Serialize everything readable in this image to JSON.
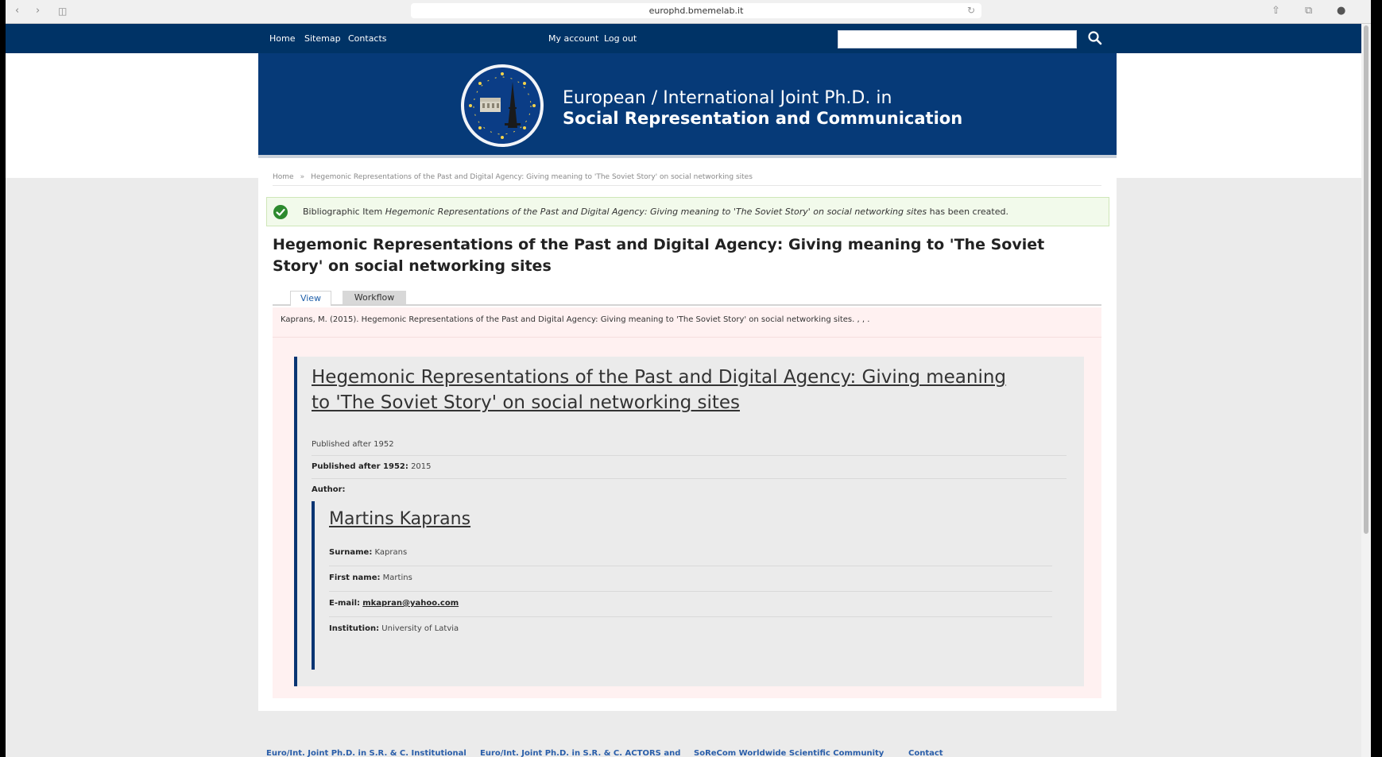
{
  "browser": {
    "url": "europhd.bmemelab.it"
  },
  "topnav": {
    "left_links": [
      "Home",
      "Sitemap",
      "Contacts"
    ],
    "account_links": [
      "My account",
      "Log out"
    ],
    "search_placeholder": ""
  },
  "banner": {
    "line1": "European / International Joint Ph.D. in",
    "line2": "Social Representation and Communication"
  },
  "breadcrumb": {
    "home": "Home",
    "separator": "»",
    "current": "Hegemonic Representations of the Past and Digital Agency: Giving meaning to 'The Soviet Story' on social networking sites"
  },
  "status": {
    "prefix": "Bibliographic Item",
    "item": "Hegemonic Representations of the Past and Digital Agency: Giving meaning to 'The Soviet Story' on social networking sites",
    "suffix": "has been created."
  },
  "page_title": "Hegemonic Representations of the Past and Digital Agency: Giving meaning to 'The Soviet Story' on social networking sites",
  "tabs": {
    "view": "View",
    "workflow": "Workflow"
  },
  "citation": "Kaprans, M. (2015). Hegemonic Representations of the Past and Digital Agency: Giving meaning to 'The Soviet Story' on social networking sites. , , .",
  "card": {
    "title": "Hegemonic Representations of the Past and Digital Agency: Giving meaning to 'The Soviet Story' on social networking sites",
    "published_label_plain": "Published after 1952",
    "published_label": "Published after 1952:",
    "published_value": "2015",
    "author_label": "Author:",
    "author": {
      "name": "Martins Kaprans",
      "surname_label": "Surname:",
      "surname": "Kaprans",
      "firstname_label": "First name:",
      "firstname": "Martins",
      "email_label": "E-mail:",
      "email": "mkapran@yahoo.com",
      "institution_label": "Institution:",
      "institution": "University of Latvia"
    }
  },
  "footer": {
    "links": [
      "Euro/Int. Joint Ph.D. in S.R. & C. Institutional",
      "Euro/Int. Joint Ph.D. in S.R. & C. ACTORS and",
      "SoReCom Worldwide Scientific Community",
      "Contact"
    ]
  },
  "colors": {
    "nav": "#003366",
    "banner": "#063a78",
    "accent_border": "#0a3573",
    "success_bg": "#f2faeb",
    "node_bg": "#fff1f1",
    "link": "#2a5ea9"
  }
}
